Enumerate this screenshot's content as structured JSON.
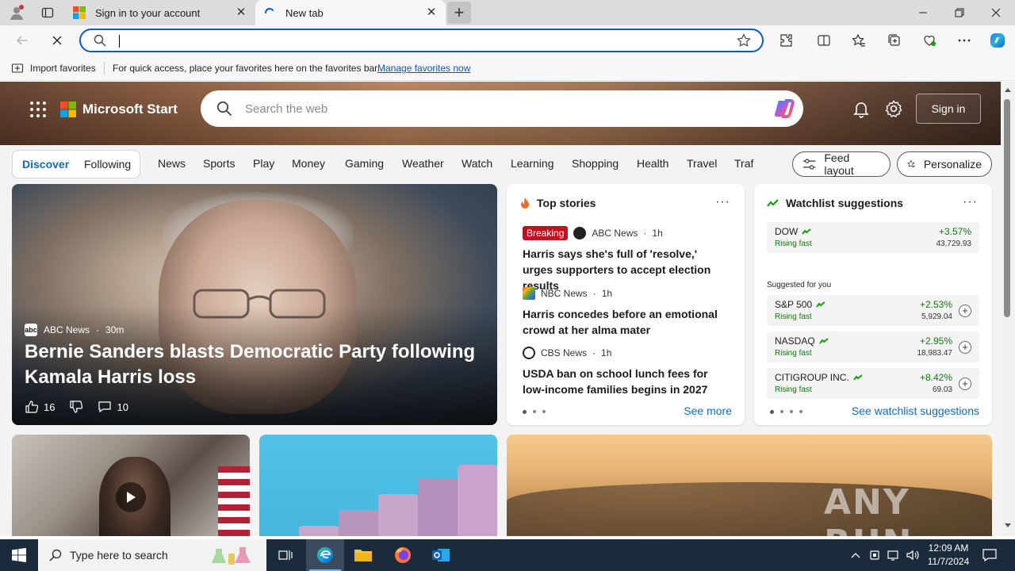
{
  "browser": {
    "tabs": [
      {
        "title": "Sign in to your account",
        "active": false
      },
      {
        "title": "New tab",
        "active": true
      }
    ],
    "address_value": "",
    "favorites_bar": {
      "import_label": "Import favorites",
      "message": "For quick access, place your favorites here on the favorites bar.",
      "manage_link": "Manage favorites now"
    }
  },
  "start": {
    "brand": "Microsoft Start",
    "search_placeholder": "Search the web",
    "signin_label": "Sign in",
    "feed_tabs": {
      "discover": "Discover",
      "following": "Following"
    },
    "categories": [
      "News",
      "Sports",
      "Play",
      "Money",
      "Gaming",
      "Weather",
      "Watch",
      "Learning",
      "Shopping",
      "Health",
      "Travel",
      "Traf"
    ],
    "feed_layout_label": "Feed layout",
    "personalize_label": "Personalize",
    "hero": {
      "source": "ABC News",
      "age": "30m",
      "headline": "Bernie Sanders blasts Democratic Party following Kamala Harris loss",
      "likes": "16",
      "comments": "10"
    },
    "top_stories": {
      "title": "Top stories",
      "items": [
        {
          "badge": "Breaking",
          "source": "ABC News",
          "age": "1h",
          "title": "Harris says she's full of 'resolve,' urges supporters to accept election results"
        },
        {
          "badge": "",
          "source": "NBC News",
          "age": "1h",
          "title": "Harris concedes before an emotional crowd at her alma mater"
        },
        {
          "badge": "",
          "source": "CBS News",
          "age": "1h",
          "title": "USDA ban on school lunch fees for low-income families begins in 2027"
        }
      ],
      "see_more": "See more"
    },
    "watchlist": {
      "title": "Watchlist suggestions",
      "top": {
        "name": "DOW",
        "status": "Rising fast",
        "change": "+3.57%",
        "value": "43,729.93"
      },
      "suggested_label": "Suggested for you",
      "items": [
        {
          "name": "S&P 500",
          "status": "Rising fast",
          "change": "+2.53%",
          "value": "5,929.04"
        },
        {
          "name": "NASDAQ",
          "status": "Rising fast",
          "change": "+2.95%",
          "value": "18,983.47"
        },
        {
          "name": "CITIGROUP INC.",
          "status": "Rising fast",
          "change": "+8.42%",
          "value": "69.03"
        }
      ],
      "see_link": "See watchlist suggestions"
    },
    "watermark": "ANY RUN"
  },
  "taskbar": {
    "search_placeholder": "Type here to search",
    "time": "12:09 AM",
    "date": "11/7/2024"
  },
  "colors": {
    "accent": "#0f6cbd",
    "address_border": "#0c59c8",
    "breaking": "#c50f1f",
    "positive": "#0e7a0d",
    "taskbar": "#1c2b3c"
  }
}
